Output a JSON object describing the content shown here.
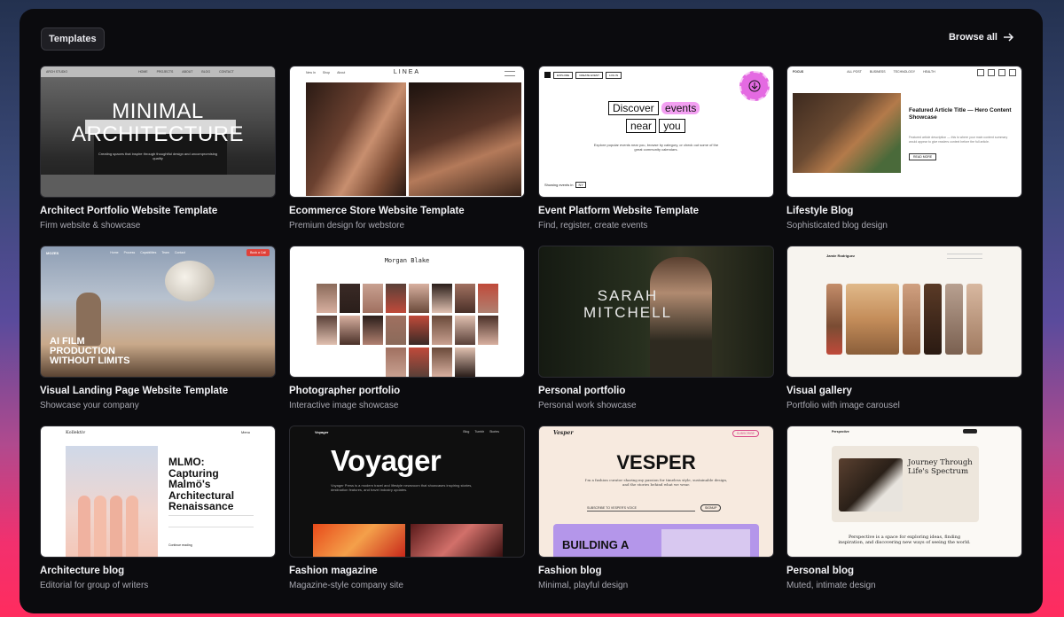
{
  "header": {
    "tag": "Templates",
    "browse": "Browse all"
  },
  "templates": [
    {
      "title": "Architect Portfolio Website Template",
      "subtitle": "Firm website & showcase",
      "preview": {
        "brand": "ARCH STUDIO",
        "nav": [
          "HOME",
          "PROJECTS",
          "ABOUT",
          "BLOG",
          "CONTACT"
        ],
        "headline_1": "MINIMAL",
        "headline_2": "ARCHITECTURE",
        "tagline": "Creating spaces that inspire through thoughtful design and uncompromising quality"
      }
    },
    {
      "title": "Ecommerce Store Website Template",
      "subtitle": "Premium design for webstore",
      "preview": {
        "brand": "LINEA",
        "nav": [
          "New In",
          "Shop",
          "About"
        ]
      }
    },
    {
      "title": "Event Platform Website Template",
      "subtitle": "Find, register, create events",
      "preview": {
        "nav": [
          "EXPLORE",
          "CREATE EVENT",
          "LOG IN"
        ],
        "w1": "Discover",
        "w2": "events",
        "w3": "near",
        "w4": "you",
        "body": "Explore popular events near you, browse by category, or check out some of the great community calendars.",
        "showing": "Showing events in",
        "city": "NY"
      }
    },
    {
      "title": "Lifestyle Blog",
      "subtitle": "Sophisticated blog design",
      "preview": {
        "brand": "FOCUS",
        "nav": [
          "ALL POST",
          "BUSINESS",
          "TECHNOLOGY",
          "HEALTH"
        ],
        "article": "Featured Article Title — Hero Content Showcase",
        "body": "Featured article description — this is where your main content summary would appear to give readers context before the full article.",
        "cta": "READ MORE"
      }
    },
    {
      "title": "Visual Landing Page Website Template",
      "subtitle": "Showcase your company",
      "preview": {
        "brand": "MOZES",
        "nav": [
          "Home",
          "Process",
          "Capabilities",
          "Team",
          "Contact"
        ],
        "cta": "Book a Call",
        "h1": "AI FILM",
        "h2": "PRODUCTION",
        "h3": "WITHOUT LIMITS"
      }
    },
    {
      "title": "Photographer portfolio",
      "subtitle": "Interactive image showcase",
      "preview": {
        "name": "Morgan Blake"
      }
    },
    {
      "title": "Personal portfolio",
      "subtitle": "Personal work showcase",
      "preview": {
        "n1": "SARAH",
        "n2": "MITCHELL"
      }
    },
    {
      "title": "Visual gallery",
      "subtitle": "Portfolio with image carousel",
      "preview": {
        "name": "Jamie Rodriguez"
      }
    },
    {
      "title": "Architecture blog",
      "subtitle": "Editorial for group of writers",
      "preview": {
        "brand": "Kollektiv",
        "menu": "Menu",
        "h1": "MLMO:",
        "h2": "Capturing",
        "h3": "Malmö's",
        "h4": "Architectural",
        "h5": "Renaissance",
        "more": "Continue reading"
      }
    },
    {
      "title": "Fashion magazine",
      "subtitle": "Magazine-style company site",
      "preview": {
        "brand": "Voyager",
        "nav": [
          "Blog",
          "Tumblr",
          "Stories"
        ],
        "headline": "Voyager",
        "body": "Voyager Press is a modern travel and lifestyle newsroom that showcases inspiring stories, destination features, and travel industry updates."
      }
    },
    {
      "title": "Fashion blog",
      "subtitle": "Minimal, playful design",
      "preview": {
        "brand": "Vesper",
        "cta": "SUBSCRIBE",
        "headline": "VESPER",
        "body": "I'm a fashion curator sharing my passion for timeless style, sustainable design, and the stories behind what we wear.",
        "field": "SUBSCRIBE TO VESPER'S VOICE",
        "signup": "SIGNUP",
        "feature": "BUILDING A"
      }
    },
    {
      "title": "Personal blog",
      "subtitle": "Muted, intimate design",
      "preview": {
        "brand": "Perspective",
        "hero": "Journey Through Life's Spectrum",
        "quote": "Perspective is a space for exploring ideas, finding inspiration, and discovering new ways of seeing the world."
      }
    }
  ],
  "colors": {
    "accent_pink": "#f3a0f2",
    "event_badge": "#d95bd9",
    "cta_red": "#e0413a",
    "vesper_purple": "#b496ea"
  }
}
